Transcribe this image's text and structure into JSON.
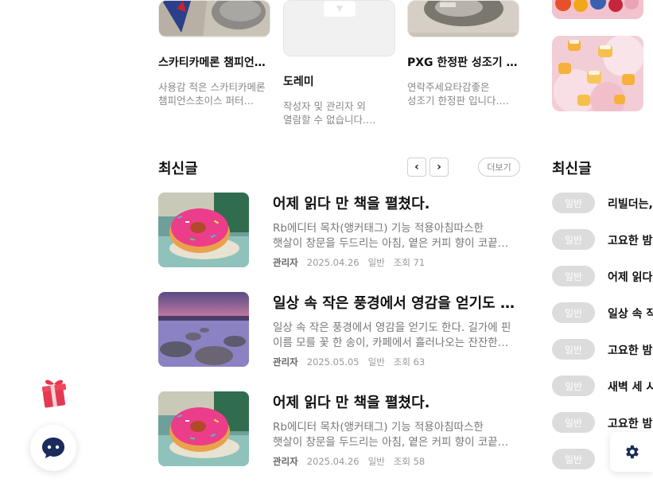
{
  "cards": [
    {
      "title": "스카티카메론 챔피언…",
      "desc": [
        "사용감 적은 스카티카메론",
        "챔피언스초이스 퍼터…"
      ]
    },
    {
      "title": "도레미",
      "desc": [
        "작성자 및 관리자 외",
        "열람할 수 없습니다.…"
      ]
    },
    {
      "title": "PXG 한정판 성조기 …",
      "desc": [
        "연락주세요타감좋은",
        "성조기 한정판 입니다.…"
      ]
    }
  ],
  "latest": {
    "title": "최신글",
    "prev_icon": "‹",
    "next_icon": "›",
    "more_label": "더보기",
    "posts": [
      {
        "title": "어제 읽다 만 책을 펼쳤다.",
        "excerpt": [
          "Rb에디터 목차(앵커태그) 기능 적용아침따스한",
          "햇살이 창문을 두드리는 아침, 옅은 커피 향이 코끝…"
        ],
        "author": "관리자",
        "date": "2025.04.26",
        "category": "일반",
        "views": "조회 71"
      },
      {
        "title": "일상 속 작은 풍경에서 영감을 얻기도 …",
        "excerpt": [
          "일상 속 작은 풍경에서 영감을 얻기도 한다. 길가에 핀",
          "이름 모를 꽃 한 송이, 카페에서 흘러나오는 잔잔한…"
        ],
        "author": "관리자",
        "date": "2025.05.05",
        "category": "일반",
        "views": "조회 63"
      },
      {
        "title": "어제 읽다 만 책을 펼쳤다.",
        "excerpt": [
          "Rb에디터 목차(앵커태그) 기능 적용아침따스한",
          "햇살이 창문을 두드리는 아침, 옅은 커피 향이 코끝…"
        ],
        "author": "관리자",
        "date": "2025.04.26",
        "category": "일반",
        "views": "조회 58"
      }
    ]
  },
  "sidebar_latest": {
    "title": "최신글",
    "items": [
      {
        "badge": "일반",
        "title": "리빌더는,"
      },
      {
        "badge": "일반",
        "title": "고요한 밤"
      },
      {
        "badge": "일반",
        "title": "어제 읽다"
      },
      {
        "badge": "일반",
        "title": "일상 속 작"
      },
      {
        "badge": "일반",
        "title": "고요한 밤"
      },
      {
        "badge": "일반",
        "title": "새벽 세 시"
      },
      {
        "badge": "일반",
        "title": "고요한 밤"
      },
      {
        "badge": "일반",
        "title": ""
      }
    ]
  },
  "icons": {
    "gift": "gift-icon",
    "chat": "chat-bubble-icon",
    "settings": "gear-icon"
  },
  "colors": {
    "badge_bg": "#dcdcdc",
    "settings_icon": "#1a2b5c",
    "chat_icon": "#1a2b5c"
  }
}
